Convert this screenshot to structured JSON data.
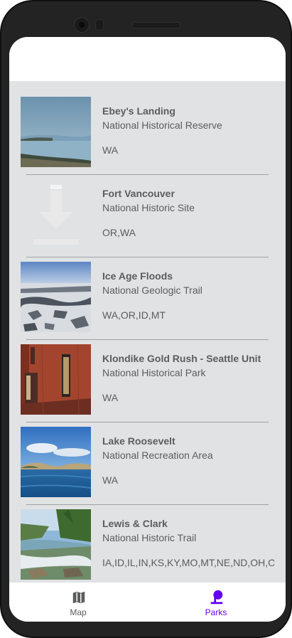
{
  "parks": [
    {
      "name": "Ebey's Landing",
      "designation": "National Historical Reserve",
      "states": "WA",
      "image": "coastal-bay-photo"
    },
    {
      "name": "Fort Vancouver",
      "designation": "National Historic Site",
      "states": "OR,WA",
      "image": "download-placeholder-icon"
    },
    {
      "name": "Ice Age Floods",
      "designation": "National Geologic Trail",
      "states": "WA,OR,ID,MT",
      "image": "snowy-plateau-photo"
    },
    {
      "name": "Klondike Gold Rush - Seattle Unit",
      "designation": "National Historical Park",
      "states": "WA",
      "image": "brick-building-photo"
    },
    {
      "name": "Lake Roosevelt",
      "designation": "National Recreation Area",
      "states": "WA",
      "image": "lake-photo"
    },
    {
      "name": "Lewis & Clark",
      "designation": "National Historic Trail",
      "states": "IA,ID,IL,IN,KS,KY,MO,MT,NE,ND,OH,OR,P",
      "image": "river-falls-photo"
    }
  ],
  "bottom_nav": {
    "items": [
      {
        "label": "Map",
        "icon": "map-icon",
        "selected": false
      },
      {
        "label": "Parks",
        "icon": "parks-icon",
        "selected": true
      }
    ]
  },
  "colors": {
    "accent": "#6200ee",
    "list_background": "#e1e2e4",
    "text": "#5b5c5f",
    "nav_inactive": "#5b5c5f"
  }
}
